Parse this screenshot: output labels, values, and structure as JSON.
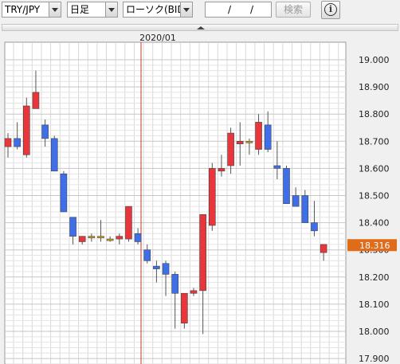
{
  "toolbar": {
    "pair": "TRY/JPY",
    "period": "日足",
    "chart_kind": "ローソク(BID)",
    "date_separator": "/",
    "search_label": "検索",
    "info_icon": "info-icon"
  },
  "colors": {
    "up": "#e8363a",
    "down": "#3e6fe8",
    "doji": "#d9a400",
    "marker": "#e06c1a",
    "date_line": "#c0392b",
    "grid": "#d9d9d9"
  },
  "chart_data": {
    "type": "candlestick",
    "title": "",
    "date_marker": "2020/01",
    "current_price": "18.316",
    "ylim": [
      17.9,
      19.05
    ],
    "y_ticks": [
      "19.000",
      "18.900",
      "18.800",
      "18.700",
      "18.600",
      "18.500",
      "18.400",
      "18.300",
      "18.200",
      "18.100",
      "18.000",
      "17.900"
    ],
    "grid": true,
    "candles": [
      {
        "o": 18.68,
        "h": 18.73,
        "l": 18.64,
        "c": 18.71
      },
      {
        "o": 18.71,
        "h": 18.77,
        "l": 18.67,
        "c": 18.68
      },
      {
        "o": 18.65,
        "h": 18.86,
        "l": 18.64,
        "c": 18.83
      },
      {
        "o": 18.82,
        "h": 18.96,
        "l": 18.82,
        "c": 18.88
      },
      {
        "o": 18.76,
        "h": 18.78,
        "l": 18.68,
        "c": 18.71
      },
      {
        "o": 18.71,
        "h": 18.72,
        "l": 18.59,
        "c": 18.59
      },
      {
        "o": 18.58,
        "h": 18.59,
        "l": 18.44,
        "c": 18.44
      },
      {
        "o": 18.42,
        "h": 18.42,
        "l": 18.32,
        "c": 18.35
      },
      {
        "o": 18.33,
        "h": 18.35,
        "l": 18.32,
        "c": 18.35
      },
      {
        "o": 18.35,
        "h": 18.36,
        "l": 18.33,
        "c": 18.35
      },
      {
        "o": 18.35,
        "h": 18.41,
        "l": 18.33,
        "c": 18.35
      },
      {
        "o": 18.34,
        "h": 18.35,
        "l": 18.33,
        "c": 18.34
      },
      {
        "o": 18.34,
        "h": 18.36,
        "l": 18.32,
        "c": 18.35
      },
      {
        "o": 18.34,
        "h": 18.46,
        "l": 18.33,
        "c": 18.46
      },
      {
        "o": 18.36,
        "h": 18.38,
        "l": 18.32,
        "c": 18.33
      },
      {
        "o": 18.3,
        "h": 18.32,
        "l": 18.25,
        "c": 18.26
      },
      {
        "o": 18.24,
        "h": 18.26,
        "l": 18.18,
        "c": 18.23
      },
      {
        "o": 18.25,
        "h": 18.26,
        "l": 18.13,
        "c": 18.21
      },
      {
        "o": 18.21,
        "h": 18.22,
        "l": 18.01,
        "c": 18.14
      },
      {
        "o": 18.03,
        "h": 18.14,
        "l": 18.01,
        "c": 18.14
      },
      {
        "o": 18.14,
        "h": 18.16,
        "l": 18.13,
        "c": 18.15
      },
      {
        "o": 18.15,
        "h": 18.43,
        "l": 17.99,
        "c": 18.43
      },
      {
        "o": 18.39,
        "h": 18.62,
        "l": 18.37,
        "c": 18.6
      },
      {
        "o": 18.59,
        "h": 18.65,
        "l": 18.57,
        "c": 18.6
      },
      {
        "o": 18.61,
        "h": 18.75,
        "l": 18.58,
        "c": 18.73
      },
      {
        "o": 18.69,
        "h": 18.77,
        "l": 18.61,
        "c": 18.7
      },
      {
        "o": 18.7,
        "h": 18.71,
        "l": 18.65,
        "c": 18.7
      },
      {
        "o": 18.67,
        "h": 18.8,
        "l": 18.65,
        "c": 18.77
      },
      {
        "o": 18.76,
        "h": 18.81,
        "l": 18.66,
        "c": 18.67
      },
      {
        "o": 18.61,
        "h": 18.7,
        "l": 18.56,
        "c": 18.6
      },
      {
        "o": 18.6,
        "h": 18.61,
        "l": 18.47,
        "c": 18.47
      },
      {
        "o": 18.5,
        "h": 18.53,
        "l": 18.47,
        "c": 18.46
      },
      {
        "o": 18.5,
        "h": 18.52,
        "l": 18.4,
        "c": 18.4
      },
      {
        "o": 18.4,
        "h": 18.48,
        "l": 18.35,
        "c": 18.37
      },
      {
        "o": 18.29,
        "h": 18.32,
        "l": 18.26,
        "c": 18.32
      }
    ]
  }
}
